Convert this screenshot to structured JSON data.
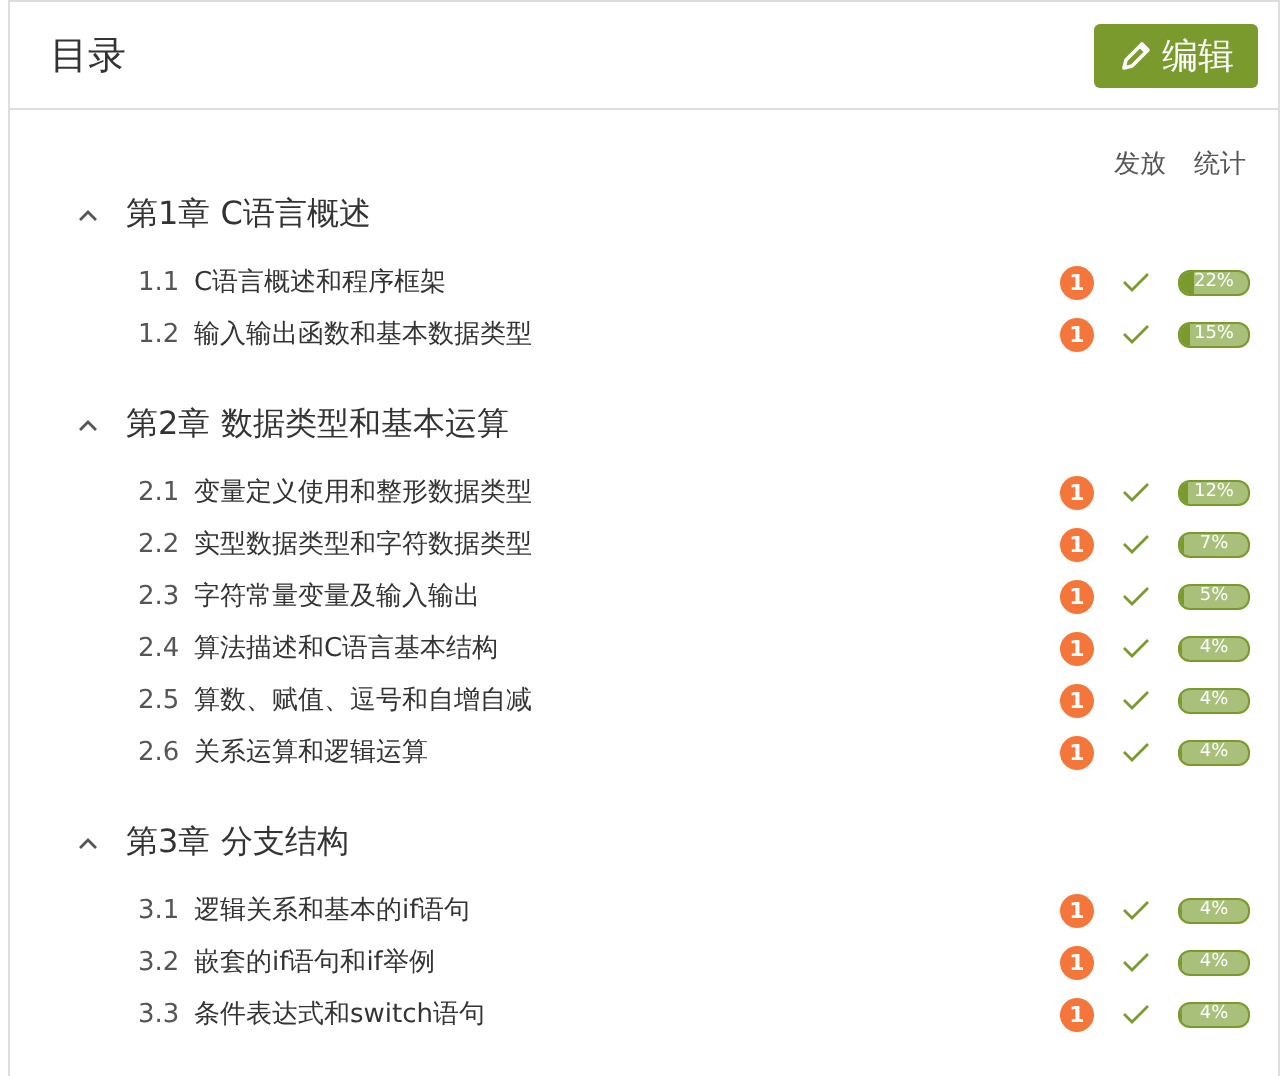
{
  "header": {
    "title": "目录",
    "edit_button": "编辑"
  },
  "columns": [
    "发放",
    "统计"
  ],
  "chapters": [
    {
      "title": "第1章 C语言概述",
      "expanded": true,
      "sections": [
        {
          "number": "1.1",
          "title": "C语言概述和程序框架",
          "badge": "1",
          "released": true,
          "level": 0.22,
          "reading": "22%"
        },
        {
          "number": "1.2",
          "title": "输入输出函数和基本数据类型",
          "badge": "1",
          "released": true,
          "level": 0.15,
          "reading": "15%"
        }
      ]
    },
    {
      "title": "第2章 数据类型和基本运算",
      "expanded": true,
      "sections": [
        {
          "number": "2.1",
          "title": "变量定义使用和整形数据类型",
          "badge": "1",
          "released": true,
          "level": 0.12,
          "reading": "12%"
        },
        {
          "number": "2.2",
          "title": "实型数据类型和字符数据类型",
          "badge": "1",
          "released": true,
          "level": 0.07,
          "reading": "7%"
        },
        {
          "number": "2.3",
          "title": "字符常量变量及输入输出",
          "badge": "1",
          "released": true,
          "level": 0.05,
          "reading": "5%"
        },
        {
          "number": "2.4",
          "title": "算法描述和C语言基本结构",
          "badge": "1",
          "released": true,
          "level": 0.04,
          "reading": "4%"
        },
        {
          "number": "2.5",
          "title": "算数、赋值、逗号和自增自减",
          "badge": "1",
          "released": true,
          "level": 0.04,
          "reading": "4%"
        },
        {
          "number": "2.6",
          "title": "关系运算和逻辑运算",
          "badge": "1",
          "released": true,
          "level": 0.04,
          "reading": "4%"
        }
      ]
    },
    {
      "title": "第3章 分支结构",
      "expanded": true,
      "sections": [
        {
          "number": "3.1",
          "title": "逻辑关系和基本的if语句",
          "badge": "1",
          "released": true,
          "level": 0.04,
          "reading": "4%"
        },
        {
          "number": "3.2",
          "title": "嵌套的if语句和if举例",
          "badge": "1",
          "released": true,
          "level": 0.04,
          "reading": "4%"
        },
        {
          "number": "3.3",
          "title": "条件表达式和switch语句",
          "badge": "1",
          "released": true,
          "level": 0.04,
          "reading": "4%"
        }
      ]
    }
  ]
}
